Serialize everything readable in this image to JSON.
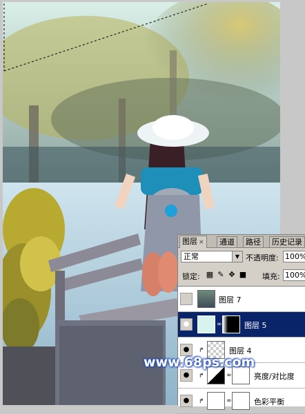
{
  "panel": {
    "tabs": [
      {
        "label": "图层",
        "close": "×"
      },
      {
        "label": "通道"
      },
      {
        "label": "路径"
      },
      {
        "label": "历史记录"
      }
    ],
    "blend_mode": "正常",
    "opacity_label": "不透明度:",
    "opacity_value": "100%",
    "lock_label": "锁定:",
    "fill_label": "填充:",
    "fill_value": "100%",
    "layers": [
      {
        "name": "图层 7",
        "visible": false,
        "selected": false
      },
      {
        "name": "图层 5",
        "visible": true,
        "selected": true
      },
      {
        "name": "图层 4",
        "visible": true,
        "selected": false
      },
      {
        "name": "亮度/对比度",
        "visible": true,
        "selected": false
      },
      {
        "name": "色彩平衡",
        "visible": true,
        "selected": false
      }
    ]
  },
  "watermark": "www.68ps.com",
  "colors": {
    "selected_layer": "#0a246a",
    "panel_bg": "#d4d0c8"
  }
}
